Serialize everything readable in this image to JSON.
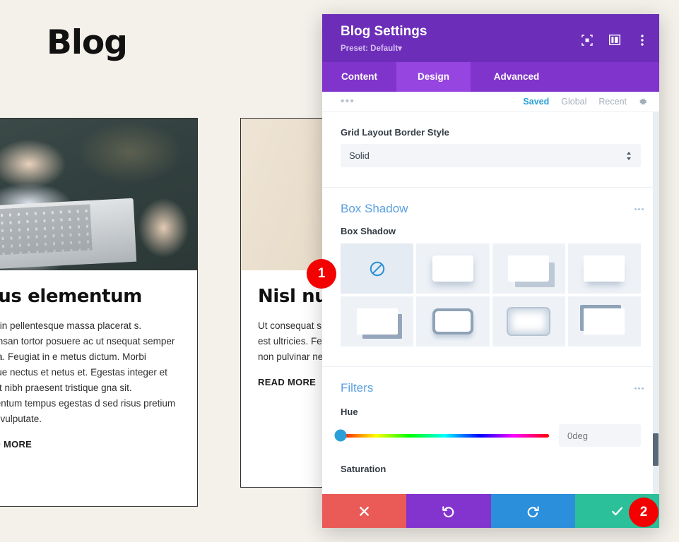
{
  "page": {
    "title": "Blog",
    "background_color": "#f4f0ea",
    "cards": [
      {
        "image_alt": "hands-writing-notebook-laptop",
        "title": "ellus elementum",
        "body": "smod in pellentesque massa placerat s. Accumsan tortor posuere ac ut nsequat semper viverra. Feugiat in e metus dictum. Morbi tristique nectus et netus et. Egestas integer et aliquet nibh praesent tristique gna sit. Elementum tempus egestas d sed risus pretium quam vulputate.",
        "read_more": "READ MORE"
      },
      {
        "image_alt": "wooden-desk-potted-plant",
        "title": "Nisl nu",
        "body": "Ut consequat s justo laoreet si amet nisl susci est ultricies. Fe diam. Donec e pharetra. Ferm non pulvinar ne vitae semper q",
        "read_more": "READ MORE"
      }
    ]
  },
  "modal": {
    "title": "Blog Settings",
    "preset": "Preset: Default",
    "preset_caret": "▾",
    "header_icons": [
      {
        "name": "focus-view-icon",
        "glyph": "focus"
      },
      {
        "name": "layout-columns-icon",
        "glyph": "columns"
      },
      {
        "name": "kebab-menu-icon",
        "glyph": "dots"
      }
    ],
    "tabs": [
      {
        "label": "Content",
        "active": false
      },
      {
        "label": "Design",
        "active": true
      },
      {
        "label": "Advanced",
        "active": false
      }
    ],
    "subtabs": {
      "dots": "•••",
      "items": [
        {
          "label": "Saved",
          "active": true
        },
        {
          "label": "Global",
          "active": false
        },
        {
          "label": "Recent",
          "active": false
        }
      ],
      "gear_icon": "gear-icon"
    },
    "fields": {
      "border_style": {
        "label": "Grid Layout Border Style",
        "value": "Solid"
      }
    },
    "box_shadow": {
      "section_title": "Box Shadow",
      "field_label": "Box Shadow",
      "presets": [
        {
          "name": "none",
          "selected": true
        },
        {
          "name": "soft-bottom",
          "selected": false
        },
        {
          "name": "offset-bottom-right",
          "selected": false
        },
        {
          "name": "close-bottom",
          "selected": false
        },
        {
          "name": "hard-bottom-right",
          "selected": false
        },
        {
          "name": "outlined",
          "selected": false
        },
        {
          "name": "inset",
          "selected": false
        },
        {
          "name": "top-left-edge",
          "selected": false
        }
      ]
    },
    "filters": {
      "section_title": "Filters",
      "hue": {
        "label": "Hue",
        "value": "0deg",
        "handle_percent": 0
      },
      "saturation": {
        "label": "Saturation"
      }
    },
    "footer": [
      {
        "name": "cancel-button",
        "icon": "✖",
        "color": "#ea5a56"
      },
      {
        "name": "undo-button",
        "icon": "↺",
        "color": "#8334cf"
      },
      {
        "name": "redo-button",
        "icon": "↻",
        "color": "#2b8fdb"
      },
      {
        "name": "save-button",
        "icon": "✔",
        "color": "#2bbf9a"
      }
    ]
  },
  "annotations": [
    {
      "label": "1"
    },
    {
      "label": "2"
    }
  ],
  "colors": {
    "header_purple": "#6c2eb9",
    "tab_purple": "#8034cc",
    "tab_active_purple": "#9645e0",
    "accent_blue": "#2a9fd8",
    "section_blue": "#5a9fe0",
    "badge_red": "#f40000"
  }
}
